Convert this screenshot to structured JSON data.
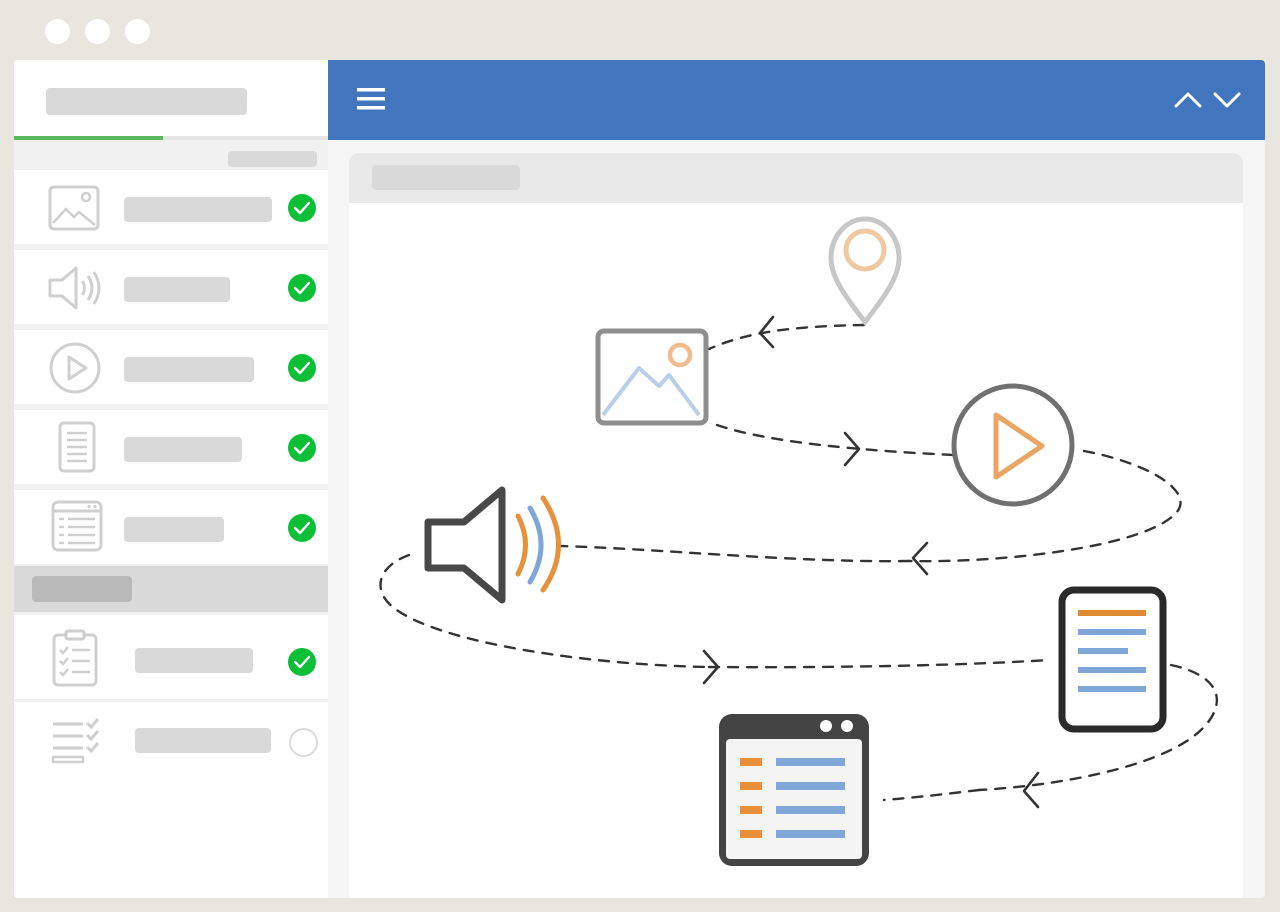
{
  "window": {
    "traffic_lights": [
      "window-dot",
      "window-dot",
      "window-dot"
    ]
  },
  "sidebar": {
    "progress_fraction": 0.475,
    "items": [
      {
        "icon": "image-icon",
        "status": "complete"
      },
      {
        "icon": "audio-icon",
        "status": "complete"
      },
      {
        "icon": "video-icon",
        "status": "complete"
      },
      {
        "icon": "document-icon",
        "status": "complete"
      },
      {
        "icon": "webpage-icon",
        "status": "complete"
      },
      {
        "icon": "quiz-icon",
        "status": "complete"
      },
      {
        "icon": "survey-icon",
        "status": "incomplete"
      }
    ]
  },
  "topbar": {
    "menu_icon": "hamburger-menu-icon",
    "prev_icon": "chevron-up-icon",
    "next_icon": "chevron-down-icon"
  },
  "illustration": {
    "icons": [
      "location-pin-icon",
      "image-icon",
      "play-icon",
      "speaker-icon",
      "document-icon",
      "webpage-icon"
    ]
  },
  "colors": {
    "accent_blue": "#4176be",
    "progress_green": "#5cb85c",
    "check_green": "#0bbf36",
    "orange": "#e8903a",
    "light_blue": "#7ea7d8",
    "dark_gray": "#444444"
  }
}
